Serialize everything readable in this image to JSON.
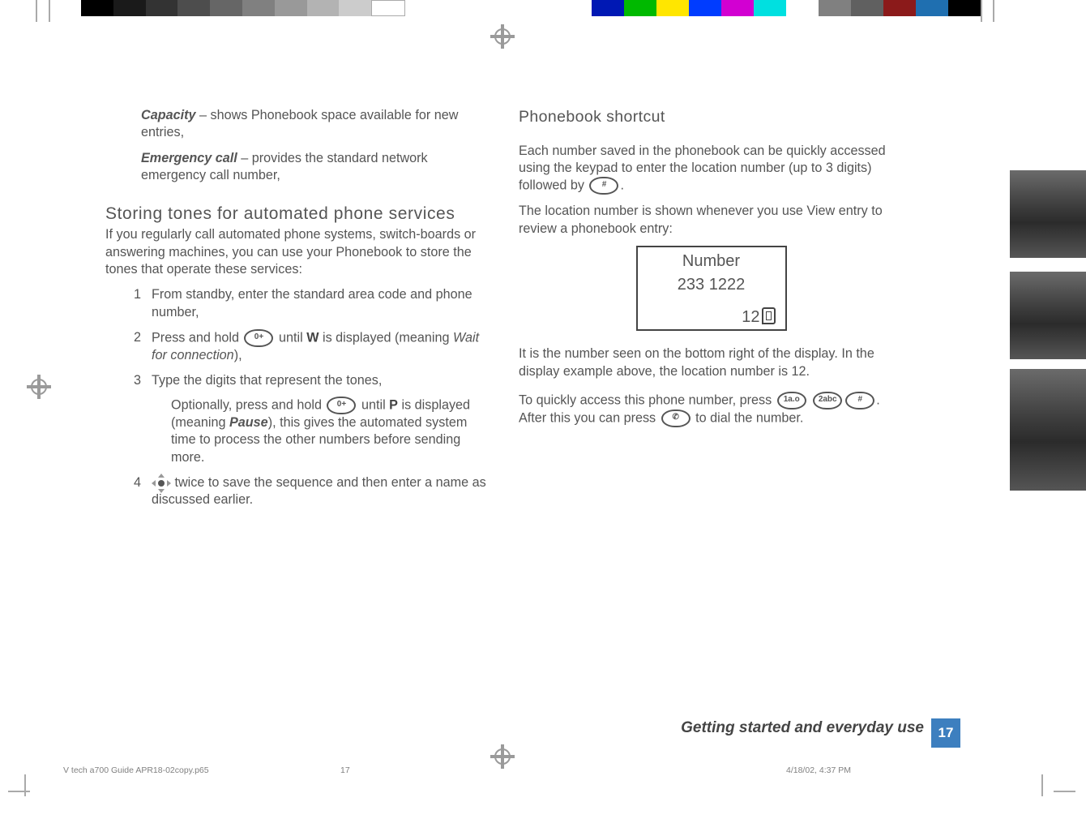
{
  "left": {
    "capacity_term": "Capacity",
    "capacity_rest": " – shows Phonebook space available for new entries,",
    "emerg_term": "Emergency call",
    "emerg_rest": " – provides the standard network emergency call number,",
    "h_storing": "Storing tones for automated phone services",
    "intro": "If you regularly call automated phone systems, switch-boards or answering machines, you can use your Phonebook to store the tones that operate these services:",
    "s1_num": "1",
    "s1": "From standby, enter the standard area code and phone number,",
    "s2_num": "2",
    "s2a": "Press and hold ",
    "s2_key": "0+",
    "s2b": " until ",
    "s2_sym": "W",
    "s2c": " is displayed (meaning ",
    "s2_wait": "Wait for connection",
    "s2d": "),",
    "s3_num": "3",
    "s3": "Type the digits that represent the tones,",
    "s3sub_a": "Optionally, press and hold ",
    "s3sub_key": "0+",
    "s3sub_b": " until ",
    "s3sub_sym": "P",
    "s3sub_c": " is displayed (meaning ",
    "s3sub_pause": "Pause",
    "s3sub_d": "), this gives the automated system time to process the other numbers before sending more.",
    "s4_num": "4",
    "s4": " twice to save the sequence and then enter a name as discussed earlier."
  },
  "right": {
    "h_shortcut": "Phonebook shortcut",
    "p1a": "Each number saved in the phonebook can be quickly accessed using the keypad to enter the location number (up to 3 digits) followed by ",
    "hash_key": "#",
    "p1b": ".",
    "p2": "The location number is shown whenever you use View entry to review a phonebook entry:",
    "disp_title": "Number",
    "disp_number": "233 1222",
    "disp_loc": "12",
    "p3": "It is the number seen on the bottom right of the display. In the display example above, the location number is 12.",
    "p4a": "To quickly access this phone number, press ",
    "k1": "1a.o",
    "k2": "2abc",
    "k3": "#",
    "p4b": ". After this you can press ",
    "call_key": "📞",
    "p4c": " to dial the number."
  },
  "footer": {
    "section": "Getting started and everyday use",
    "page": "17",
    "file": "V tech a700 Guide APR18-02copy.p65",
    "print_page": "17",
    "timestamp": "4/18/02, 4:37 PM"
  },
  "colors": {
    "left_swatches": [
      "#000",
      "#1a1a1a",
      "#333",
      "#4d4d4d",
      "#666",
      "#808080",
      "#999",
      "#b3b3b3",
      "#ccc",
      "#fff"
    ],
    "right_swatches": [
      "#0018b4",
      "#00b900",
      "#ffe600",
      "#003cff",
      "#d200d2",
      "#00e0e0",
      "#fff",
      "#808080",
      "#606060",
      "#8b1a1a",
      "#1f6fb0",
      "#000"
    ]
  }
}
